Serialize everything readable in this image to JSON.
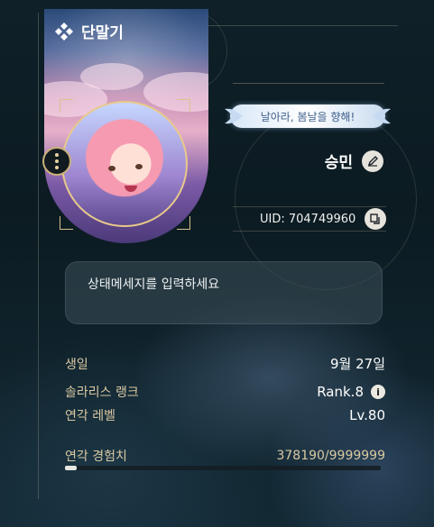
{
  "header": {
    "title": "단말기",
    "icon": "diamond-cluster-icon"
  },
  "profile": {
    "banner_text": "날아라, 봄날을 향해!",
    "name": "승민",
    "uid_label": "UID: 704749960",
    "status_placeholder": "상태메세지를 입력하세요"
  },
  "info": {
    "birthday_label": "생일",
    "birthday_value": "9월 27일",
    "rank_label": "솔라리스 랭크",
    "rank_value": "Rank.8",
    "level_label": "연각 레벨",
    "level_value": "Lv.80",
    "exp_label": "연각 경험치",
    "exp_value": "378190/9999999",
    "exp_progress": 0.0378
  },
  "colors": {
    "accent_gold": "#d9c8a3",
    "background": "#0b1a22"
  }
}
